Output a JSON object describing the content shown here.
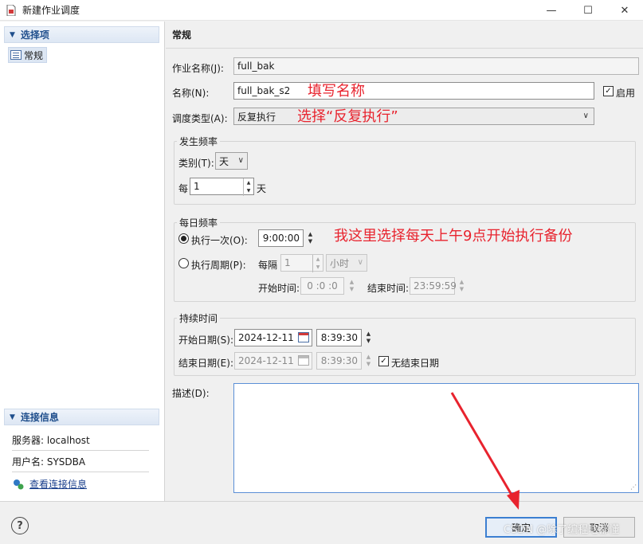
{
  "window": {
    "title": "新建作业调度",
    "minimize": "—",
    "maximize": "☐",
    "close": "✕"
  },
  "sidebar": {
    "options_header": "选择项",
    "nav_item": "常规",
    "conn_header": "连接信息",
    "server": "服务器: localhost",
    "user": "用户名: SYSDBA",
    "view_conn_link": "查看连接信息"
  },
  "main": {
    "section_title": "常规",
    "job_name_label": "作业名称(J):",
    "job_name_value": "full_bak",
    "name_label": "名称(N):",
    "name_value": "full_bak_s2",
    "enabled_label": "启用",
    "schedule_type_label": "调度类型(A):",
    "schedule_type_value": "反复执行",
    "freq_group": "发生频率",
    "category_label": "类别(T):",
    "category_value": "天",
    "every_label": "每",
    "every_value": "1",
    "every_unit": "天",
    "daily_group": "每日频率",
    "once_label": "执行一次(O):",
    "once_time": "9:00:00",
    "period_label": "执行周期(P):",
    "interval_label": "每隔",
    "interval_value": "1",
    "interval_unit": "小时",
    "start_time_label": "开始时间:",
    "start_time_value": "0 :0 :0",
    "end_time_label": "结束时间:",
    "end_time_value": "23:59:59",
    "duration_group": "持续时间",
    "start_date_label": "开始日期(S):",
    "start_date_value": "2024-12-11",
    "start_date_time": "8:39:30",
    "end_date_label": "结束日期(E):",
    "end_date_value": "2024-12-11",
    "end_date_time": "8:39:30",
    "no_end_label": "无结束日期",
    "desc_label": "描述(D):"
  },
  "annotations": {
    "name_note": "填写名称",
    "type_note": "选择“反复执行”",
    "daily_note": "我这里选择每天上午9点开始执行备份",
    "color": "#e8232e"
  },
  "footer": {
    "ok": "确定",
    "cancel": "取消",
    "help": "?",
    "watermark": "CSDN @除了编程啥都懂"
  }
}
